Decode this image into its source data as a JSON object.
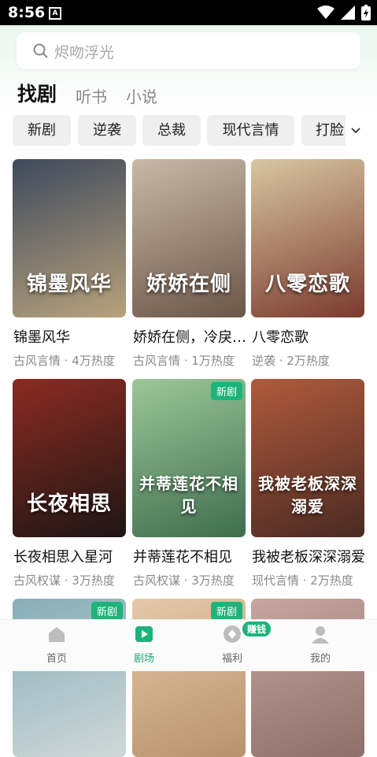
{
  "status": {
    "time": "8:56",
    "notif": "A"
  },
  "search": {
    "placeholder": "烬吻浮光"
  },
  "tabs": [
    "找剧",
    "听书",
    "小说"
  ],
  "chips": [
    "新剧",
    "逆袭",
    "总裁",
    "现代言情",
    "打脸"
  ],
  "cards": [
    {
      "poster_text": "锦墨风华",
      "title": "锦墨风华",
      "meta": "古风言情 · 4万热度",
      "badge": "",
      "c1": "#3e4a5c",
      "c2": "#b8a27c"
    },
    {
      "poster_text": "娇娇在侧",
      "title": "娇娇在侧，冷戾权臣也被撩动凡心",
      "meta": "古风言情 · 1万热度",
      "badge": "",
      "c1": "#c9b8a8",
      "c2": "#6b5648"
    },
    {
      "poster_text": "八零恋歌",
      "title": "八零恋歌",
      "meta": "逆袭 · 2万热度",
      "badge": "",
      "c1": "#d8c7a2",
      "c2": "#7b3a2e"
    },
    {
      "poster_text": "长夜相思",
      "title": "长夜相思入星河",
      "meta": "古风权谋 · 3万热度",
      "badge": "",
      "c1": "#8b2b22",
      "c2": "#1e1614"
    },
    {
      "poster_text": "并蒂莲花不相见",
      "title": "并蒂莲花不相见",
      "meta": "古风权谋 · 3万热度",
      "badge": "新剧",
      "c1": "#9cc79a",
      "c2": "#3f6e4d"
    },
    {
      "poster_text": "我被老板深深溺爱",
      "title": "我被老板深深溺爱",
      "meta": "现代言情 · 2万热度",
      "badge": "",
      "c1": "#b05a3c",
      "c2": "#4a2a22"
    },
    {
      "poster_text": "",
      "title": "",
      "meta": "",
      "badge": "新剧",
      "c1": "#87aeb8",
      "c2": "#cfd8d8"
    },
    {
      "poster_text": "",
      "title": "",
      "meta": "",
      "badge": "新剧",
      "c1": "#e6c8a8",
      "c2": "#b7926c"
    },
    {
      "poster_text": "",
      "title": "",
      "meta": "",
      "badge": "",
      "c1": "#c8a5a0",
      "c2": "#8e6f6a"
    }
  ],
  "nav": [
    {
      "label": "首页",
      "icon": "home-icon"
    },
    {
      "label": "剧场",
      "icon": "theater-play-icon"
    },
    {
      "label": "福利",
      "icon": "coin-icon"
    },
    {
      "label": "我的",
      "icon": "user-icon"
    }
  ],
  "earn_badge": "赚钱",
  "colors": {
    "accent": "#1db37a",
    "chip_bg": "#efefef"
  }
}
